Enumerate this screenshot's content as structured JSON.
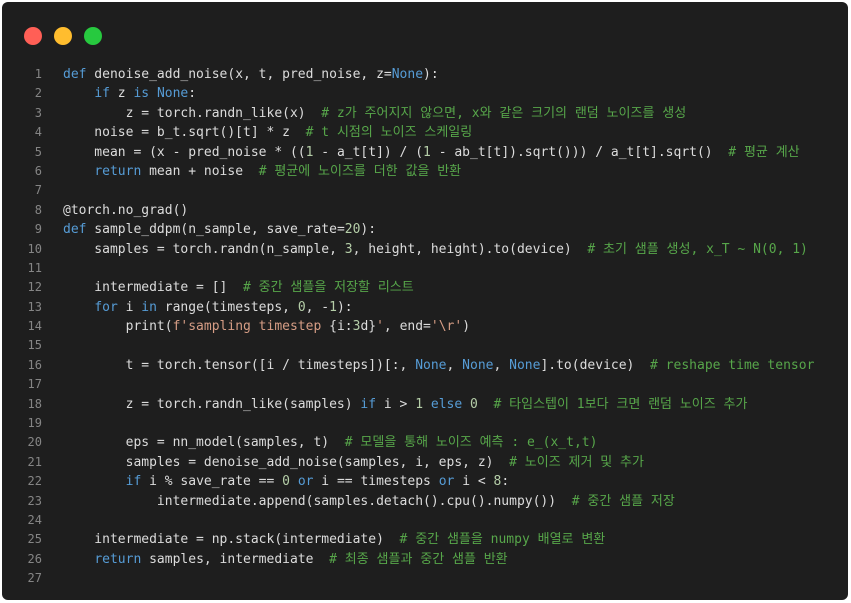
{
  "window": {
    "buttons": {
      "close": "close",
      "minimize": "minimize",
      "maximize": "maximize"
    }
  },
  "code": {
    "lines": [
      {
        "n": "1",
        "tokens": [
          [
            "kw",
            "def"
          ],
          [
            "pl",
            " denoise_add_noise(x, t, pred_noise, z="
          ],
          [
            "kw",
            "None"
          ],
          [
            "pl",
            "):"
          ]
        ]
      },
      {
        "n": "2",
        "tokens": [
          [
            "pl",
            "    "
          ],
          [
            "kw",
            "if"
          ],
          [
            "pl",
            " z "
          ],
          [
            "kw",
            "is"
          ],
          [
            "pl",
            " "
          ],
          [
            "kw",
            "None"
          ],
          [
            "pl",
            ":"
          ]
        ]
      },
      {
        "n": "3",
        "tokens": [
          [
            "pl",
            "        z = torch.randn_like(x)  "
          ],
          [
            "cm",
            "# z가 주어지지 않으면, x와 같은 크기의 랜덤 노이즈를 생성"
          ]
        ]
      },
      {
        "n": "4",
        "tokens": [
          [
            "pl",
            "    noise = b_t.sqrt()[t] * z  "
          ],
          [
            "cm",
            "# t 시점의 노이즈 스케일링"
          ]
        ]
      },
      {
        "n": "5",
        "tokens": [
          [
            "pl",
            "    mean = (x - pred_noise * (("
          ],
          [
            "nm",
            "1"
          ],
          [
            "pl",
            " - a_t[t]) / ("
          ],
          [
            "nm",
            "1"
          ],
          [
            "pl",
            " - ab_t[t]).sqrt())) / a_t[t].sqrt()  "
          ],
          [
            "cm",
            "# 평균 계산"
          ]
        ]
      },
      {
        "n": "6",
        "tokens": [
          [
            "pl",
            "    "
          ],
          [
            "kw",
            "return"
          ],
          [
            "pl",
            " mean + noise  "
          ],
          [
            "cm",
            "# 평균에 노이즈를 더한 값을 반환"
          ]
        ]
      },
      {
        "n": "7",
        "tokens": []
      },
      {
        "n": "8",
        "tokens": [
          [
            "pl",
            "@torch.no_grad()"
          ]
        ]
      },
      {
        "n": "9",
        "tokens": [
          [
            "kw",
            "def"
          ],
          [
            "pl",
            " sample_ddpm(n_sample, save_rate="
          ],
          [
            "nm",
            "20"
          ],
          [
            "pl",
            "):"
          ]
        ]
      },
      {
        "n": "10",
        "tokens": [
          [
            "pl",
            "    samples = torch.randn(n_sample, "
          ],
          [
            "nm",
            "3"
          ],
          [
            "pl",
            ", height, height).to(device)  "
          ],
          [
            "cm",
            "# 초기 샘플 생성, x_T ~ N(0, 1)"
          ]
        ]
      },
      {
        "n": "11",
        "tokens": []
      },
      {
        "n": "12",
        "tokens": [
          [
            "pl",
            "    intermediate = []  "
          ],
          [
            "cm",
            "# 중간 샘플을 저장할 리스트"
          ]
        ]
      },
      {
        "n": "13",
        "tokens": [
          [
            "pl",
            "    "
          ],
          [
            "kw",
            "for"
          ],
          [
            "pl",
            " i "
          ],
          [
            "kw",
            "in"
          ],
          [
            "pl",
            " range(timesteps, "
          ],
          [
            "nm",
            "0"
          ],
          [
            "pl",
            ", -"
          ],
          [
            "nm",
            "1"
          ],
          [
            "pl",
            "):"
          ]
        ]
      },
      {
        "n": "14",
        "tokens": [
          [
            "pl",
            "        print("
          ],
          [
            "st",
            "f'sampling timestep "
          ],
          [
            "pl",
            "{i:"
          ],
          [
            "nm",
            "3"
          ],
          [
            "pl",
            "d}"
          ],
          [
            "st",
            "'"
          ],
          [
            "pl",
            ", end="
          ],
          [
            "st",
            "'\\r'"
          ],
          [
            "pl",
            ")"
          ]
        ]
      },
      {
        "n": "15",
        "tokens": []
      },
      {
        "n": "16",
        "tokens": [
          [
            "pl",
            "        t = torch.tensor([i / timesteps])[:, "
          ],
          [
            "kw",
            "None"
          ],
          [
            "pl",
            ", "
          ],
          [
            "kw",
            "None"
          ],
          [
            "pl",
            ", "
          ],
          [
            "kw",
            "None"
          ],
          [
            "pl",
            "].to(device)  "
          ],
          [
            "cm",
            "# reshape time tensor"
          ]
        ]
      },
      {
        "n": "17",
        "tokens": []
      },
      {
        "n": "18",
        "tokens": [
          [
            "pl",
            "        z = torch.randn_like(samples) "
          ],
          [
            "kw",
            "if"
          ],
          [
            "pl",
            " i > "
          ],
          [
            "nm",
            "1"
          ],
          [
            "pl",
            " "
          ],
          [
            "kw",
            "else"
          ],
          [
            "pl",
            " "
          ],
          [
            "nm",
            "0"
          ],
          [
            "pl",
            "  "
          ],
          [
            "cm",
            "# 타임스텝이 1보다 크면 랜덤 노이즈 추가"
          ]
        ]
      },
      {
        "n": "19",
        "tokens": []
      },
      {
        "n": "20",
        "tokens": [
          [
            "pl",
            "        eps = nn_model(samples, t)  "
          ],
          [
            "cm",
            "# 모델을 통해 노이즈 예측 : e_(x_t,t)"
          ]
        ]
      },
      {
        "n": "21",
        "tokens": [
          [
            "pl",
            "        samples = denoise_add_noise(samples, i, eps, z)  "
          ],
          [
            "cm",
            "# 노이즈 제거 및 추가"
          ]
        ]
      },
      {
        "n": "22",
        "tokens": [
          [
            "pl",
            "        "
          ],
          [
            "kw",
            "if"
          ],
          [
            "pl",
            " i % save_rate == "
          ],
          [
            "nm",
            "0"
          ],
          [
            "pl",
            " "
          ],
          [
            "kw",
            "or"
          ],
          [
            "pl",
            " i == timesteps "
          ],
          [
            "kw",
            "or"
          ],
          [
            "pl",
            " i < "
          ],
          [
            "nm",
            "8"
          ],
          [
            "pl",
            ":"
          ]
        ]
      },
      {
        "n": "23",
        "tokens": [
          [
            "pl",
            "            intermediate.append(samples.detach().cpu().numpy())  "
          ],
          [
            "cm",
            "# 중간 샘플 저장"
          ]
        ]
      },
      {
        "n": "24",
        "tokens": []
      },
      {
        "n": "25",
        "tokens": [
          [
            "pl",
            "    intermediate = np.stack(intermediate)  "
          ],
          [
            "cm",
            "# 중간 샘플을 numpy 배열로 변환"
          ]
        ]
      },
      {
        "n": "26",
        "tokens": [
          [
            "pl",
            "    "
          ],
          [
            "kw",
            "return"
          ],
          [
            "pl",
            " samples, intermediate  "
          ],
          [
            "cm",
            "# 최종 샘플과 중간 샘플 반환"
          ]
        ]
      },
      {
        "n": "27",
        "tokens": []
      }
    ]
  }
}
